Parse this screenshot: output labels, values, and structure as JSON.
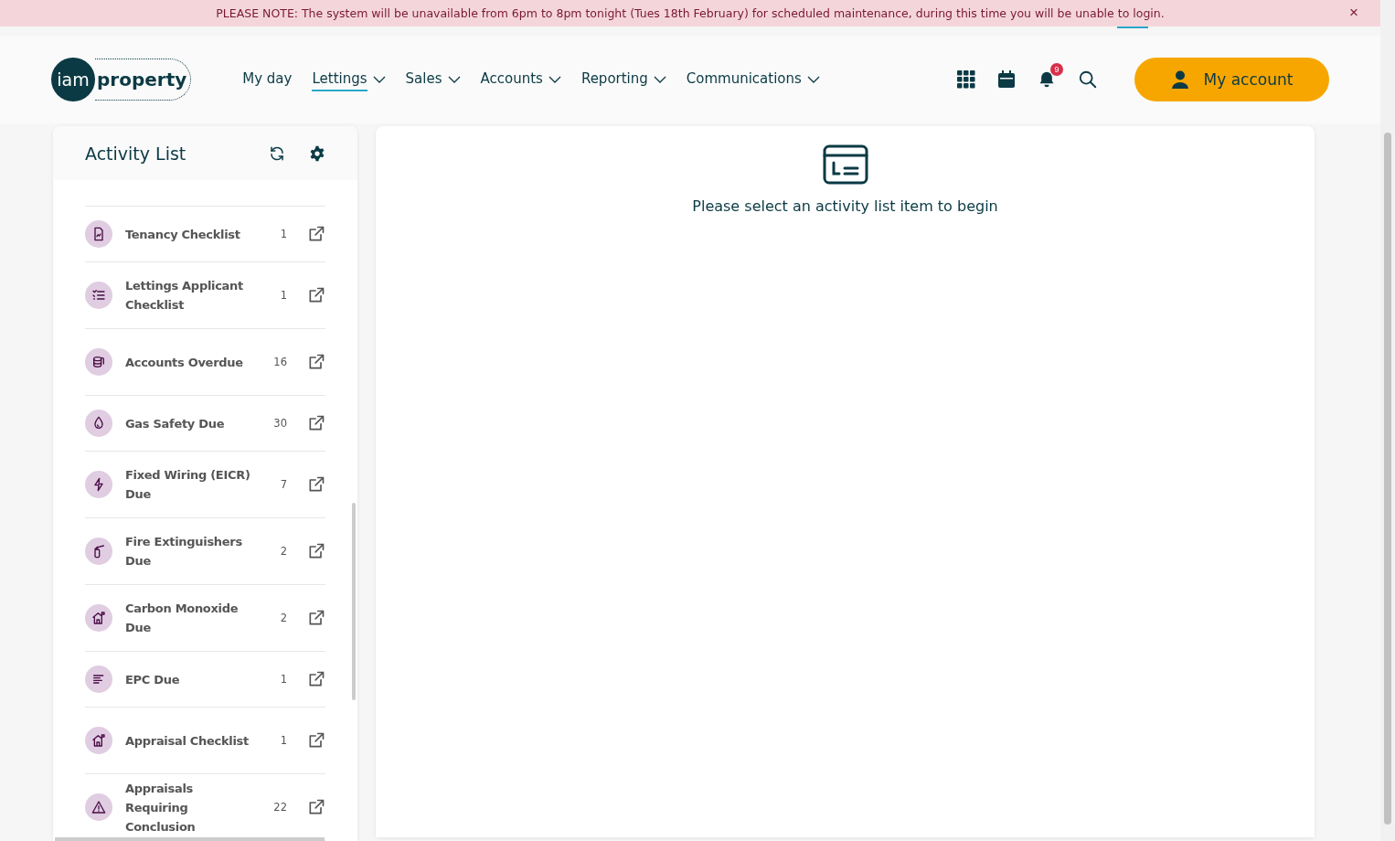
{
  "banner": {
    "message": "PLEASE NOTE: The system will be unavailable from 6pm to 8pm tonight (Tues 18th February) for scheduled maintenance, during this time you will be unable to login.",
    "close": "×"
  },
  "header": {
    "logo_left": "iam",
    "logo_right": "property",
    "nav": [
      {
        "label": "My day",
        "selected": false,
        "dropdown": false
      },
      {
        "label": "Lettings",
        "selected": true,
        "dropdown": true
      },
      {
        "label": "Sales",
        "selected": false,
        "dropdown": true
      },
      {
        "label": "Accounts",
        "selected": false,
        "dropdown": true
      },
      {
        "label": "Reporting",
        "selected": false,
        "dropdown": true
      },
      {
        "label": "Communications",
        "selected": false,
        "dropdown": true
      }
    ],
    "notification_count": "9",
    "account_button": "My account"
  },
  "activity_list": {
    "title": "Activity List",
    "items": [
      {
        "kind": "document",
        "label": "Tenancy Checklist",
        "count": "1"
      },
      {
        "kind": "checklist",
        "label": "Lettings Applicant Checklist",
        "count": "1"
      },
      {
        "kind": "coins",
        "label": "Accounts Overdue",
        "count": "16"
      },
      {
        "kind": "drop",
        "label": "Gas Safety Due",
        "count": "30"
      },
      {
        "kind": "bolt",
        "label": "Fixed Wiring (EICR) Due",
        "count": "7"
      },
      {
        "kind": "extinguisher",
        "label": "Fire Extinguishers Due",
        "count": "2"
      },
      {
        "kind": "house",
        "label": "Carbon Monoxide Due",
        "count": "2"
      },
      {
        "kind": "bars",
        "label": "EPC Due",
        "count": "1"
      },
      {
        "kind": "house",
        "label": "Appraisal Checklist",
        "count": "1"
      },
      {
        "kind": "warning",
        "label": "Appraisals Requiring Conclusion",
        "count": "22"
      }
    ]
  },
  "main": {
    "message": "Please select an activity list item to begin"
  }
}
